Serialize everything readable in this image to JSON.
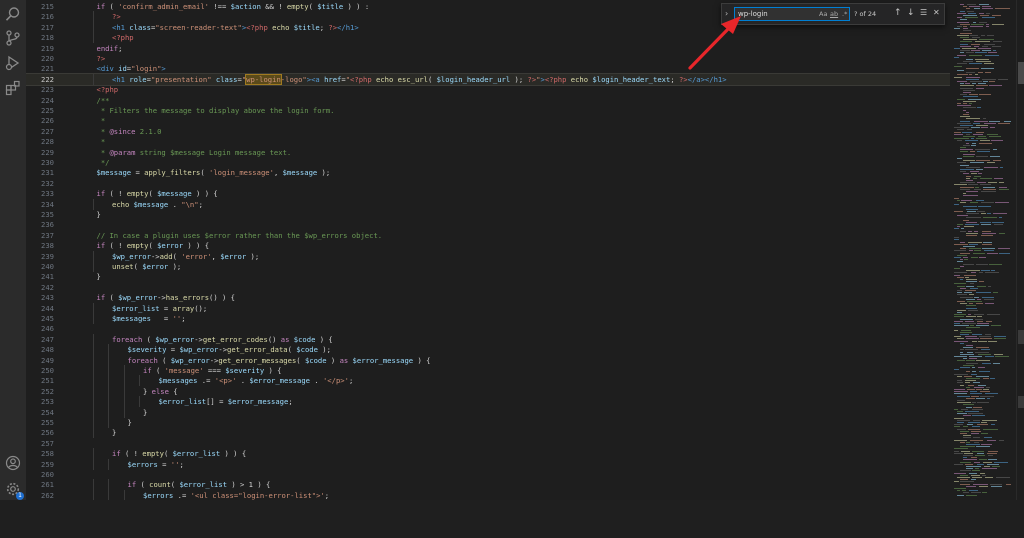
{
  "activity_bar": [
    {
      "name": "search-icon"
    },
    {
      "name": "source-control-icon"
    },
    {
      "name": "run-debug-icon"
    },
    {
      "name": "extensions-icon"
    },
    {
      "name": "account-icon"
    },
    {
      "name": "settings-gear-icon",
      "badge": "1"
    }
  ],
  "find_widget": {
    "query": "wp-login",
    "toggle_label": "›",
    "match_case_label": "Aa",
    "whole_word_label": "ab",
    "regex_label": ".*",
    "result_count": "? of 24",
    "prev_label": "↑",
    "next_label": "↓",
    "selection_label": "☰",
    "close_label": "✕"
  },
  "editor": {
    "lines": [
      {
        "n": "215",
        "indent": 1,
        "tokens": [
          [
            "kw",
            "if"
          ],
          [
            "op",
            " ( "
          ],
          [
            "str",
            "'confirm_admin_email'"
          ],
          [
            "op",
            " !== "
          ],
          [
            "var",
            "$action"
          ],
          [
            "op",
            " && ! "
          ],
          [
            "fn",
            "empty"
          ],
          [
            "op",
            "( "
          ],
          [
            "var",
            "$title"
          ],
          [
            "op",
            " ) ) :"
          ]
        ]
      },
      {
        "n": "216",
        "indent": 2,
        "tokens": [
          [
            "php",
            "?>"
          ]
        ]
      },
      {
        "n": "217",
        "indent": 2,
        "tokens": [
          [
            "tag",
            "<h1"
          ],
          [
            "attr",
            " class"
          ],
          [
            "op",
            "="
          ],
          [
            "str",
            "\"screen-reader-text\""
          ],
          [
            "tag",
            ">"
          ],
          [
            "php",
            "<?php"
          ],
          [
            "op",
            " "
          ],
          [
            "fn",
            "echo"
          ],
          [
            "op",
            " "
          ],
          [
            "var",
            "$title"
          ],
          [
            "op",
            "; "
          ],
          [
            "php",
            "?>"
          ],
          [
            "tag",
            "</h1>"
          ]
        ]
      },
      {
        "n": "218",
        "indent": 2,
        "tokens": [
          [
            "php",
            "<?php"
          ]
        ]
      },
      {
        "n": "219",
        "indent": 1,
        "tokens": [
          [
            "kw",
            "endif"
          ],
          [
            "op",
            ";"
          ]
        ]
      },
      {
        "n": "220",
        "indent": 1,
        "tokens": [
          [
            "php",
            "?>"
          ]
        ]
      },
      {
        "n": "221",
        "indent": 1,
        "tokens": [
          [
            "tag",
            "<div"
          ],
          [
            "attr",
            " id"
          ],
          [
            "op",
            "="
          ],
          [
            "str",
            "\"login\""
          ],
          [
            "tag",
            ">"
          ]
        ]
      },
      {
        "n": "222",
        "indent": 2,
        "active": true,
        "tokens": [
          [
            "tag",
            "<h1"
          ],
          [
            "attr",
            " role"
          ],
          [
            "op",
            "="
          ],
          [
            "str",
            "\"presentation\""
          ],
          [
            "attr",
            " class"
          ],
          [
            "op",
            "="
          ],
          [
            "str",
            "\""
          ],
          [
            "hl",
            "wp-login"
          ],
          [
            "str",
            "-logo\""
          ],
          [
            "tag",
            "><a"
          ],
          [
            "attr",
            " href"
          ],
          [
            "op",
            "="
          ],
          [
            "str",
            "\""
          ],
          [
            "php",
            "<?php"
          ],
          [
            "op",
            " "
          ],
          [
            "fn",
            "echo"
          ],
          [
            "op",
            " "
          ],
          [
            "fn",
            "esc_url"
          ],
          [
            "op",
            "( "
          ],
          [
            "var",
            "$login_header_url"
          ],
          [
            "op",
            " ); "
          ],
          [
            "php",
            "?>"
          ],
          [
            "str",
            "\""
          ],
          [
            "tag",
            ">"
          ],
          [
            "php",
            "<?php"
          ],
          [
            "op",
            " "
          ],
          [
            "fn",
            "echo"
          ],
          [
            "op",
            " "
          ],
          [
            "var",
            "$login_header_text"
          ],
          [
            "op",
            "; "
          ],
          [
            "php",
            "?>"
          ],
          [
            "tag",
            "</a></h1>"
          ]
        ]
      },
      {
        "n": "223",
        "indent": 1,
        "tokens": [
          [
            "php",
            "<?php"
          ]
        ]
      },
      {
        "n": "224",
        "indent": 1,
        "tokens": [
          [
            "cm",
            "/**"
          ]
        ]
      },
      {
        "n": "225",
        "indent": 1,
        "tokens": [
          [
            "cm",
            " * Filters the message to display above the login form."
          ]
        ]
      },
      {
        "n": "226",
        "indent": 1,
        "tokens": [
          [
            "cm",
            " *"
          ]
        ]
      },
      {
        "n": "227",
        "indent": 1,
        "tokens": [
          [
            "cm",
            " * "
          ],
          [
            "ann",
            "@since"
          ],
          [
            "cm",
            " 2.1.0"
          ]
        ]
      },
      {
        "n": "228",
        "indent": 1,
        "tokens": [
          [
            "cm",
            " *"
          ]
        ]
      },
      {
        "n": "229",
        "indent": 1,
        "tokens": [
          [
            "cm",
            " * "
          ],
          [
            "ann",
            "@param"
          ],
          [
            "cm",
            " string $message Login message text."
          ]
        ]
      },
      {
        "n": "230",
        "indent": 1,
        "tokens": [
          [
            "cm",
            " */"
          ]
        ]
      },
      {
        "n": "231",
        "indent": 1,
        "tokens": [
          [
            "var",
            "$message"
          ],
          [
            "op",
            " = "
          ],
          [
            "fn",
            "apply_filters"
          ],
          [
            "op",
            "( "
          ],
          [
            "str",
            "'login_message'"
          ],
          [
            "op",
            ", "
          ],
          [
            "var",
            "$message"
          ],
          [
            "op",
            " );"
          ]
        ]
      },
      {
        "n": "232",
        "indent": 0,
        "tokens": []
      },
      {
        "n": "233",
        "indent": 1,
        "tokens": [
          [
            "kw",
            "if"
          ],
          [
            "op",
            " ( ! "
          ],
          [
            "fn",
            "empty"
          ],
          [
            "op",
            "( "
          ],
          [
            "var",
            "$message"
          ],
          [
            "op",
            " ) ) {"
          ]
        ]
      },
      {
        "n": "234",
        "indent": 2,
        "tokens": [
          [
            "fn",
            "echo"
          ],
          [
            "op",
            " "
          ],
          [
            "var",
            "$message"
          ],
          [
            "op",
            " . "
          ],
          [
            "str",
            "\"\\n\""
          ],
          [
            "op",
            ";"
          ]
        ]
      },
      {
        "n": "235",
        "indent": 1,
        "tokens": [
          [
            "op",
            "}"
          ]
        ]
      },
      {
        "n": "236",
        "indent": 0,
        "tokens": []
      },
      {
        "n": "237",
        "indent": 1,
        "tokens": [
          [
            "cm",
            "// In case a plugin uses $error rather than the $wp_errors object."
          ]
        ]
      },
      {
        "n": "238",
        "indent": 1,
        "tokens": [
          [
            "kw",
            "if"
          ],
          [
            "op",
            " ( ! "
          ],
          [
            "fn",
            "empty"
          ],
          [
            "op",
            "( "
          ],
          [
            "var",
            "$error"
          ],
          [
            "op",
            " ) ) {"
          ]
        ]
      },
      {
        "n": "239",
        "indent": 2,
        "tokens": [
          [
            "var",
            "$wp_error"
          ],
          [
            "op",
            "->"
          ],
          [
            "fn",
            "add"
          ],
          [
            "op",
            "( "
          ],
          [
            "str",
            "'error'"
          ],
          [
            "op",
            ", "
          ],
          [
            "var",
            "$error"
          ],
          [
            "op",
            " );"
          ]
        ]
      },
      {
        "n": "240",
        "indent": 2,
        "tokens": [
          [
            "fn",
            "unset"
          ],
          [
            "op",
            "( "
          ],
          [
            "var",
            "$error"
          ],
          [
            "op",
            " );"
          ]
        ]
      },
      {
        "n": "241",
        "indent": 1,
        "tokens": [
          [
            "op",
            "}"
          ]
        ]
      },
      {
        "n": "242",
        "indent": 0,
        "tokens": []
      },
      {
        "n": "243",
        "indent": 1,
        "tokens": [
          [
            "kw",
            "if"
          ],
          [
            "op",
            " ( "
          ],
          [
            "var",
            "$wp_error"
          ],
          [
            "op",
            "->"
          ],
          [
            "fn",
            "has_errors"
          ],
          [
            "op",
            "() ) {"
          ]
        ]
      },
      {
        "n": "244",
        "indent": 2,
        "tokens": [
          [
            "var",
            "$error_list"
          ],
          [
            "op",
            " = "
          ],
          [
            "fn",
            "array"
          ],
          [
            "op",
            "();"
          ]
        ]
      },
      {
        "n": "245",
        "indent": 2,
        "tokens": [
          [
            "var",
            "$messages"
          ],
          [
            "op",
            "   = "
          ],
          [
            "str",
            "''"
          ],
          [
            "op",
            ";"
          ]
        ]
      },
      {
        "n": "246",
        "indent": 0,
        "tokens": []
      },
      {
        "n": "247",
        "indent": 2,
        "tokens": [
          [
            "kw",
            "foreach"
          ],
          [
            "op",
            " ( "
          ],
          [
            "var",
            "$wp_error"
          ],
          [
            "op",
            "->"
          ],
          [
            "fn",
            "get_error_codes"
          ],
          [
            "op",
            "() "
          ],
          [
            "kw",
            "as"
          ],
          [
            "op",
            " "
          ],
          [
            "var",
            "$code"
          ],
          [
            "op",
            " ) {"
          ]
        ]
      },
      {
        "n": "248",
        "indent": 3,
        "tokens": [
          [
            "var",
            "$severity"
          ],
          [
            "op",
            " = "
          ],
          [
            "var",
            "$wp_error"
          ],
          [
            "op",
            "->"
          ],
          [
            "fn",
            "get_error_data"
          ],
          [
            "op",
            "( "
          ],
          [
            "var",
            "$code"
          ],
          [
            "op",
            " );"
          ]
        ]
      },
      {
        "n": "249",
        "indent": 3,
        "tokens": [
          [
            "kw",
            "foreach"
          ],
          [
            "op",
            " ( "
          ],
          [
            "var",
            "$wp_error"
          ],
          [
            "op",
            "->"
          ],
          [
            "fn",
            "get_error_messages"
          ],
          [
            "op",
            "( "
          ],
          [
            "var",
            "$code"
          ],
          [
            "op",
            " ) "
          ],
          [
            "kw",
            "as"
          ],
          [
            "op",
            " "
          ],
          [
            "var",
            "$error_message"
          ],
          [
            "op",
            " ) {"
          ]
        ]
      },
      {
        "n": "250",
        "indent": 4,
        "tokens": [
          [
            "kw",
            "if"
          ],
          [
            "op",
            " ( "
          ],
          [
            "str",
            "'message'"
          ],
          [
            "op",
            " === "
          ],
          [
            "var",
            "$severity"
          ],
          [
            "op",
            " ) {"
          ]
        ]
      },
      {
        "n": "251",
        "indent": 5,
        "tokens": [
          [
            "var",
            "$messages"
          ],
          [
            "op",
            " .= "
          ],
          [
            "str",
            "'<p>'"
          ],
          [
            "op",
            " . "
          ],
          [
            "var",
            "$error_message"
          ],
          [
            "op",
            " . "
          ],
          [
            "str",
            "'</p>'"
          ],
          [
            "op",
            ";"
          ]
        ]
      },
      {
        "n": "252",
        "indent": 4,
        "tokens": [
          [
            "op",
            "} "
          ],
          [
            "kw",
            "else"
          ],
          [
            "op",
            " {"
          ]
        ]
      },
      {
        "n": "253",
        "indent": 5,
        "tokens": [
          [
            "var",
            "$error_list"
          ],
          [
            "op",
            "[] = "
          ],
          [
            "var",
            "$error_message"
          ],
          [
            "op",
            ";"
          ]
        ]
      },
      {
        "n": "254",
        "indent": 4,
        "tokens": [
          [
            "op",
            "}"
          ]
        ]
      },
      {
        "n": "255",
        "indent": 3,
        "tokens": [
          [
            "op",
            "}"
          ]
        ]
      },
      {
        "n": "256",
        "indent": 2,
        "tokens": [
          [
            "op",
            "}"
          ]
        ]
      },
      {
        "n": "257",
        "indent": 0,
        "tokens": []
      },
      {
        "n": "258",
        "indent": 2,
        "tokens": [
          [
            "kw",
            "if"
          ],
          [
            "op",
            " ( ! "
          ],
          [
            "fn",
            "empty"
          ],
          [
            "op",
            "( "
          ],
          [
            "var",
            "$error_list"
          ],
          [
            "op",
            " ) ) {"
          ]
        ]
      },
      {
        "n": "259",
        "indent": 3,
        "tokens": [
          [
            "var",
            "$errors"
          ],
          [
            "op",
            " = "
          ],
          [
            "str",
            "''"
          ],
          [
            "op",
            ";"
          ]
        ]
      },
      {
        "n": "260",
        "indent": 0,
        "tokens": []
      },
      {
        "n": "261",
        "indent": 3,
        "tokens": [
          [
            "kw",
            "if"
          ],
          [
            "op",
            " ( "
          ],
          [
            "fn",
            "count"
          ],
          [
            "op",
            "( "
          ],
          [
            "var",
            "$error_list"
          ],
          [
            "op",
            " ) > 1 ) {"
          ]
        ]
      },
      {
        "n": "262",
        "indent": 4,
        "tokens": [
          [
            "var",
            "$errors"
          ],
          [
            "op",
            " .= "
          ],
          [
            "str",
            "'<ul class=\"login-error-list\">'"
          ],
          [
            "op",
            ";"
          ]
        ]
      },
      {
        "n": "263",
        "indent": 0,
        "tokens": []
      }
    ]
  }
}
